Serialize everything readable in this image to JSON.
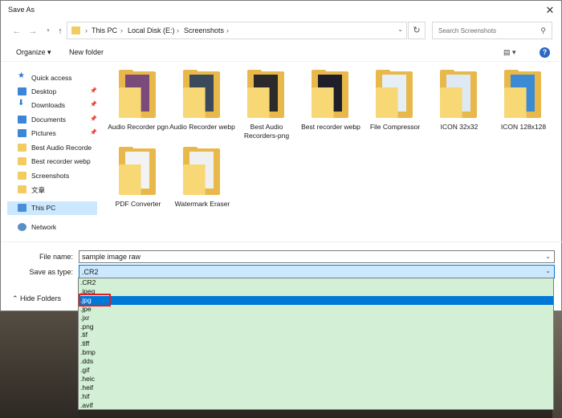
{
  "window": {
    "title": "Save As",
    "close_glyph": "✕"
  },
  "nav": {
    "back_icon": "back-arrow-icon",
    "forward_icon": "forward-arrow-icon",
    "breadcrumbs": [
      "This PC",
      "Local Disk (E:)",
      "Screenshots"
    ],
    "search_placeholder": "Search Screenshots"
  },
  "toolbar": {
    "organize_label": "Organize ▾",
    "new_folder_label": "New folder",
    "view_label": "▤ ▾",
    "help_label": "?"
  },
  "sidebar": {
    "items": [
      {
        "label": "Quick access",
        "icon": "star"
      },
      {
        "label": "Desktop",
        "icon": "blue",
        "pinned": true
      },
      {
        "label": "Downloads",
        "icon": "arrow",
        "pinned": true
      },
      {
        "label": "Documents",
        "icon": "blue",
        "pinned": true
      },
      {
        "label": "Pictures",
        "icon": "blue",
        "pinned": true
      },
      {
        "label": "Best Audio Recorde",
        "icon": "folder"
      },
      {
        "label": "Best recorder webp",
        "icon": "folder"
      },
      {
        "label": "Screenshots",
        "icon": "folder"
      },
      {
        "label": "文章",
        "icon": "folder"
      },
      {
        "label": "This PC",
        "icon": "pc",
        "selected": true
      },
      {
        "label": "Network",
        "icon": "net"
      }
    ]
  },
  "files": [
    {
      "name": "Audio Recorder pgn",
      "paper": "#7a4a7a"
    },
    {
      "name": "Audio Recorder webp",
      "paper": "#3a4a5a"
    },
    {
      "name": "Best Audio Recorders-png",
      "paper": "#2a2a2a"
    },
    {
      "name": "Best recorder webp",
      "paper": "#1f1f2a"
    },
    {
      "name": "File Compressor",
      "paper": "#e6eef6"
    },
    {
      "name": "ICON 32x32",
      "paper": "#dfe9f3"
    },
    {
      "name": "ICON 128x128",
      "paper": "#3a8ad4"
    },
    {
      "name": "PDF Converter",
      "paper": "#f3f3f3"
    },
    {
      "name": "Watermark Eraser",
      "paper": "#f0f0f0"
    }
  ],
  "form": {
    "file_name_label": "File name:",
    "file_name_value": "sample image raw",
    "save_as_type_label": "Save as type:",
    "save_as_type_value": ".CR2"
  },
  "hide_folders_label": "⌃  Hide Folders",
  "type_options": [
    ".CR2",
    ".jpeg",
    ".jpg",
    ".jpe",
    ".jxr",
    ".png",
    ".tif",
    ".tiff",
    ".bmp",
    ".dds",
    ".gif",
    ".heic",
    ".heif",
    ".hif",
    ".avif"
  ],
  "selected_option": ".jpg",
  "colors": {
    "highlight": "#0078d7",
    "list_bg": "#d3efd6",
    "annotation": "#e01e26"
  }
}
